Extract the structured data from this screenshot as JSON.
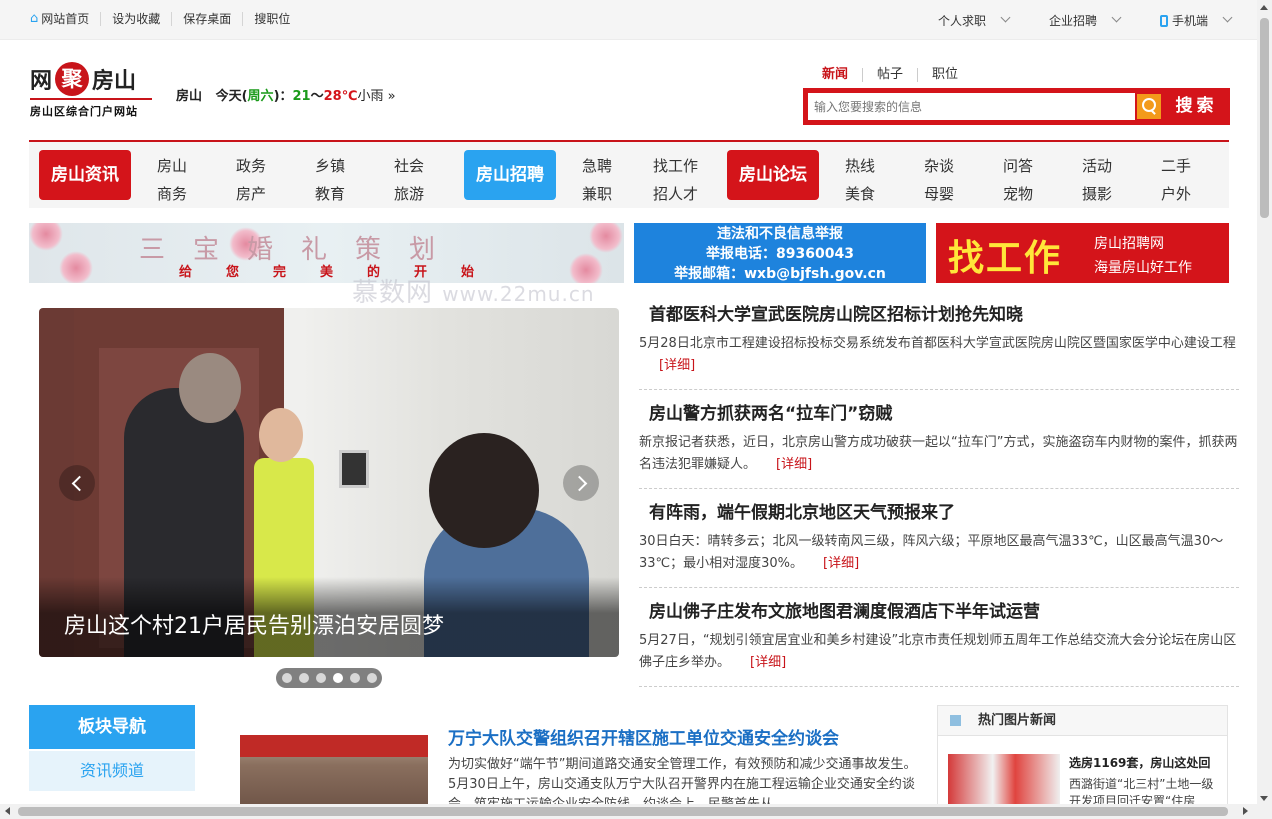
{
  "topbar": {
    "home": "网站首页",
    "favorite": "设为收藏",
    "save_desktop": "保存桌面",
    "search_job": "搜职位",
    "personal": "个人求职",
    "company": "企业招聘",
    "mobile": "手机端"
  },
  "logo": {
    "left": "网",
    "seal": "聚",
    "right": "房山",
    "subtitle": "房山区综合门户网站"
  },
  "weather": {
    "city": "房山",
    "today": "今天(",
    "weekday": "周六",
    "close": ")：",
    "low": "21",
    "sep": "～",
    "high": "28℃",
    "cond": "小雨 »"
  },
  "search": {
    "tabs": [
      "新闻",
      "帖子",
      "职位"
    ],
    "placeholder": "输入您要搜索的信息",
    "button": "搜索"
  },
  "nav": {
    "block1": "房山资讯",
    "block2": "房山招聘",
    "block3": "房山论坛",
    "cols": [
      [
        "房山",
        "商务"
      ],
      [
        "政务",
        "房产"
      ],
      [
        "乡镇",
        "教育"
      ],
      [
        "社会",
        "旅游"
      ],
      [
        "急聘",
        "兼职"
      ],
      [
        "找工作",
        "招人才"
      ],
      [
        "热线",
        "美食"
      ],
      [
        "杂谈",
        "母婴"
      ],
      [
        "问答",
        "宠物"
      ],
      [
        "活动",
        "摄影"
      ],
      [
        "二手",
        "户外"
      ]
    ]
  },
  "banners": {
    "wedding_title": "三宝婚礼策划",
    "wedding_sub": "给您完美的开始",
    "report_title": "违法和不良信息举报",
    "report_phone": "举报电话：89360043",
    "report_email": "举报邮箱：wxb@bjfsh.gov.cn",
    "job_big": "找工作",
    "job_s1": "房山招聘网",
    "job_s2": "海量房山好工作"
  },
  "watermark": {
    "name": "慕数网",
    "url": "www.22mu.cn"
  },
  "slider": {
    "caption": "房山这个村21户居民告别漂泊安居圆梦",
    "dot_count": 6,
    "active_dot": 4
  },
  "news": [
    {
      "title": "首都医科大学宣武医院房山院区招标计划抢先知晓",
      "summary": "5月28日北京市工程建设招标投标交易系统发布首都医科大学宣武医院房山院区暨国家医学中心建设工程",
      "more": "[详细]"
    },
    {
      "title": "房山警方抓获两名“拉车门”窃贼",
      "summary": "新京报记者获悉，近日，北京房山警方成功破获一起以“拉车门”方式，实施盗窃车内财物的案件，抓获两名违法犯罪嫌疑人。",
      "more": "[详细]"
    },
    {
      "title": "有阵雨，端午假期北京地区天气预报来了",
      "summary": "30日白天：晴转多云；北风一级转南风三级，阵风六级；平原地区最高气温33℃，山区最高气温30～33℃；最小相对湿度30%。",
      "more": "[详细]"
    },
    {
      "title": "房山佛子庄发布文旅地图君澜度假酒店下半年试运营",
      "summary": "5月27日，“规划引领宜居宜业和美乡村建设”北京市责任规划师五周年工作总结交流大会分论坛在房山区佛子庄乡举办。",
      "more": "[详细]"
    }
  ],
  "board": {
    "title": "板块导航",
    "item": "资讯频道"
  },
  "article": {
    "title": "万宁大队交警组织召开辖区施工单位交通安全约谈会",
    "summary": "为切实做好“端午节”期间道路交通安全管理工作，有效预防和减少交通事故发生。5月30日上午，房山交通支队万宁大队召开警界内在施工程运输企业交通安全约谈会，筑牢施工运输企业安全防线。约谈会上，民警首先从"
  },
  "hot": {
    "title": "热门图片新闻",
    "item_title": "选房1169套，房山这处回",
    "item_desc": "西潞街道“北三村”土地一级开发项目回迁安置“住房"
  }
}
